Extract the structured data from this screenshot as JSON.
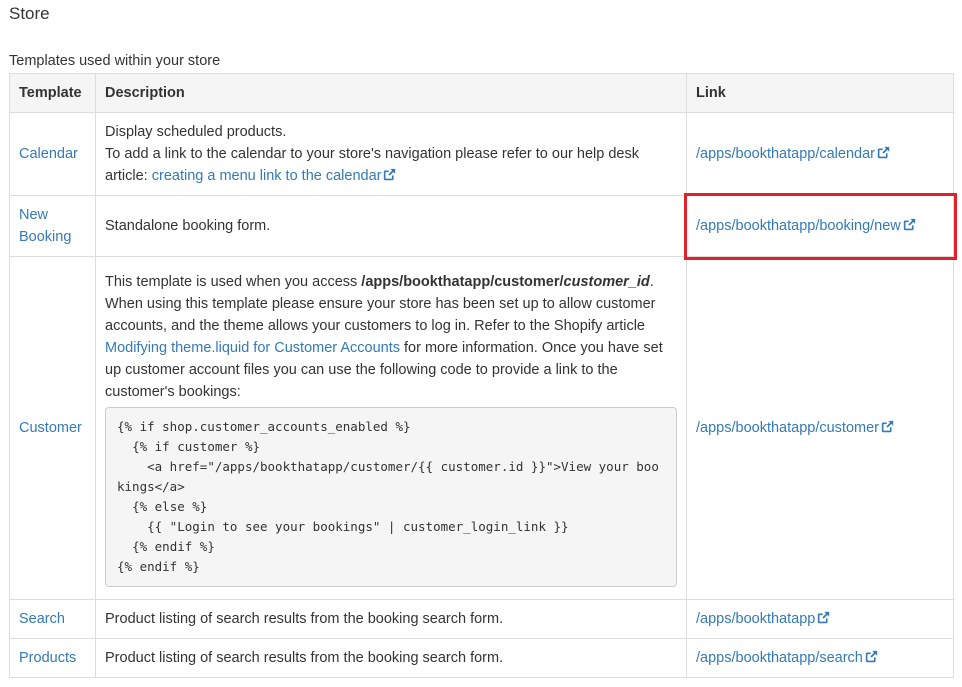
{
  "page": {
    "title": "Store",
    "caption": "Templates used within your store"
  },
  "table": {
    "headers": {
      "template": "Template",
      "description": "Description",
      "link": "Link"
    },
    "rows": [
      {
        "template": "Calendar",
        "description_lines": [
          "Display scheduled products.",
          "To add a link to the calendar to your store's navigation please refer to our help desk article: "
        ],
        "description_link": "creating a menu link to the calendar",
        "link": "/apps/bookthatapp/calendar"
      },
      {
        "template": "New Booking",
        "description": "Standalone booking form.",
        "link": "/apps/bookthatapp/booking/new",
        "highlighted": true
      },
      {
        "template": "Customer",
        "description_intro": "This template is used when you access ",
        "description_path": "/apps/bookthatapp/customer/",
        "description_path_var": "customer_id",
        "description_after_path": ". When using this template please ensure your store has been set up to allow customer accounts, and the theme allows your customers to log in. Refer to the Shopify article ",
        "description_link": "Modifying theme.liquid for Customer Accounts",
        "description_end": " for more information. Once you have set up customer account files you can use the following code to provide a link to the customer's bookings:",
        "code": "{% if shop.customer_accounts_enabled %}\n  {% if customer %}\n    <a href=\"/apps/bookthatapp/customer/{{ customer.id }}\">View your bookings</a>\n  {% else %}\n    {{ \"Login to see your bookings\" | customer_login_link }}\n  {% endif %}\n{% endif %}",
        "link": "/apps/bookthatapp/customer"
      },
      {
        "template": "Search",
        "description": "Product listing of search results from the booking search form.",
        "link": "/apps/bookthatapp"
      },
      {
        "template": "Products",
        "description": "Product listing of search results from the booking search form.",
        "link": "/apps/bookthatapp/search"
      }
    ]
  },
  "icons": {
    "external_link": "external-link-icon"
  },
  "colors": {
    "link": "#337ab7",
    "highlight": "#e0202a",
    "header_bg": "#f5f5f5",
    "border": "#dddddd"
  }
}
